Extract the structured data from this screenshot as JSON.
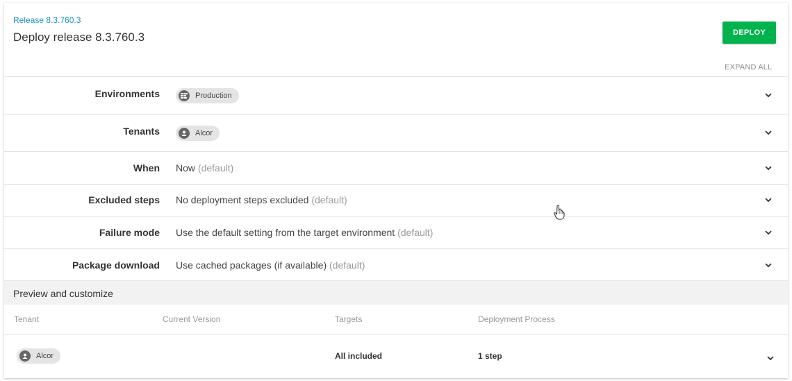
{
  "header": {
    "breadcrumb": "Release 8.3.760.3",
    "title": "Deploy release 8.3.760.3",
    "deploy_label": "DEPLOY",
    "expand_all_label": "EXPAND ALL",
    "deploy_color": "#00b34d",
    "link_color": "#1a90c6"
  },
  "sections": {
    "environments": {
      "label": "Environments",
      "chip": "Production",
      "chip_icon": "environment-icon"
    },
    "tenants": {
      "label": "Tenants",
      "chip": "Alcor",
      "chip_icon": "user-icon"
    },
    "when": {
      "label": "When",
      "value": "Now",
      "default": "(default)"
    },
    "excluded_steps": {
      "label": "Excluded steps",
      "value": "No deployment steps excluded",
      "default": "(default)"
    },
    "failure_mode": {
      "label": "Failure mode",
      "value": "Use the default setting from the target environment",
      "default": "(default)"
    },
    "package_download": {
      "label": "Package download",
      "value": "Use cached packages (if available)",
      "default": "(default)"
    }
  },
  "preview": {
    "title": "Preview and customize",
    "columns": [
      "Tenant",
      "Current Version",
      "Targets",
      "Deployment Process"
    ],
    "rows": [
      {
        "tenant": "Alcor",
        "current_version": "",
        "targets": "All included",
        "process": "1 step"
      }
    ]
  }
}
